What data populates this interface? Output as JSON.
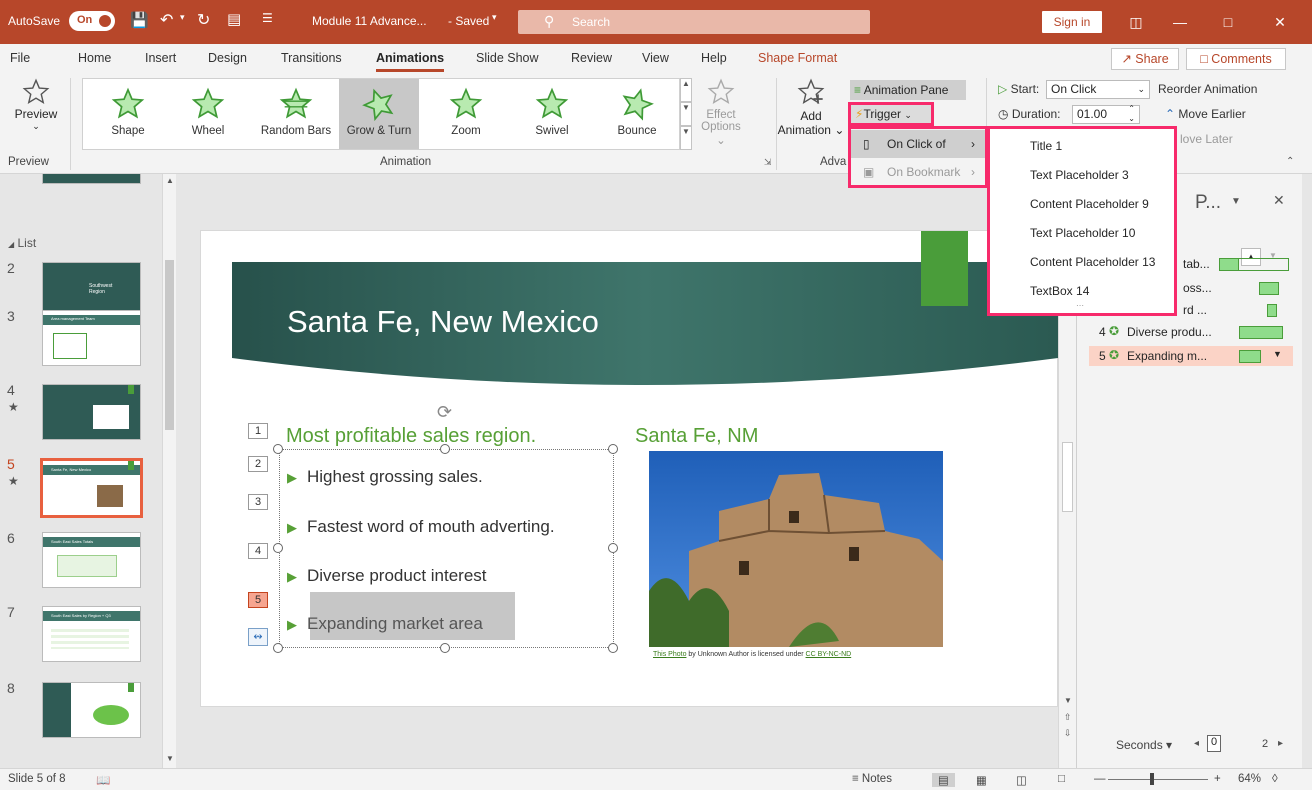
{
  "titlebar": {
    "autosave_label": "AutoSave",
    "autosave_state": "On",
    "doc_title": "Module 11 Advance...",
    "saved_state": "- Saved",
    "search_placeholder": "Search",
    "signin_label": "Sign in",
    "colors": {
      "bar": "#b7472a"
    }
  },
  "tabs": [
    {
      "label": "File"
    },
    {
      "label": "Home"
    },
    {
      "label": "Insert"
    },
    {
      "label": "Design"
    },
    {
      "label": "Transitions"
    },
    {
      "label": "Animations"
    },
    {
      "label": "Slide Show"
    },
    {
      "label": "Review"
    },
    {
      "label": "View"
    },
    {
      "label": "Help"
    },
    {
      "label": "Shape Format"
    }
  ],
  "active_tab": "Animations",
  "share_label": "Share",
  "comments_label": "Comments",
  "ribbon": {
    "preview_label": "Preview",
    "group_preview": "Preview",
    "group_animation": "Animation",
    "group_advanced": "Adva",
    "gallery": [
      "Shape",
      "Wheel",
      "Random Bars",
      "Grow & Turn",
      "Zoom",
      "Swivel",
      "Bounce"
    ],
    "gallery_selected": "Grow & Turn",
    "effect_options": "Effect",
    "effect_options2": "Options",
    "add_animation": "Add",
    "add_animation2": "Animation",
    "animation_pane": "Animation Pane",
    "trigger": "Trigger",
    "start_label": "Start:",
    "start_value": "On Click",
    "duration_label": "Duration:",
    "duration_value": "01.00",
    "reorder": "Reorder Animation",
    "move_earlier": "Move Earlier",
    "move_later": "love Later"
  },
  "trigger_menu": {
    "on_click_of": "On Click of",
    "on_bookmark": "On Bookmark",
    "items": [
      "Title 1",
      "Text Placeholder 3",
      "Content Placeholder 9",
      "Text Placeholder 10",
      "Content Placeholder 13",
      "TextBox 14"
    ]
  },
  "thumbnails": {
    "section": "List",
    "slides": [
      {
        "num": "2",
        "star": "",
        "text": "Southwest Region"
      },
      {
        "num": "3",
        "star": "",
        "text": "Area management Team"
      },
      {
        "num": "4",
        "star": "★",
        "text": ""
      },
      {
        "num": "5",
        "star": "★",
        "text": "Santa Fe, New Mexico"
      },
      {
        "num": "6",
        "star": "",
        "text": "South East Sales Totals"
      },
      {
        "num": "7",
        "star": "",
        "text": "South East Sales by Region + Q3"
      },
      {
        "num": "8",
        "star": "",
        "text": ""
      }
    ],
    "active": "5"
  },
  "slide": {
    "title": "Santa Fe, New Mexico",
    "subhead_left": "Most profitable sales region.",
    "subhead_right": "Santa Fe, NM",
    "bullets": [
      "Highest grossing sales.",
      "Fastest word of mouth adverting.",
      "Diverse product interest",
      "Expanding market area"
    ],
    "anim_tags": [
      "1",
      "2",
      "3",
      "4",
      "5"
    ],
    "caption_link1": "This Photo",
    "caption_mid": " by Unknown Author is licensed under ",
    "caption_link2": "CC BY-NC-ND"
  },
  "animation_pane": {
    "title": "P...",
    "rows": [
      {
        "num": "",
        "label": "tab...",
        "bar": 0.12
      },
      {
        "num": "",
        "label": "oss...",
        "bar": 0.12
      },
      {
        "num": "",
        "label": "rd ...",
        "bar": 0.05
      },
      {
        "num": "4",
        "label": "Diverse produ...",
        "bar": 0.25
      },
      {
        "num": "5",
        "label": "Expanding m...",
        "bar": 0.12
      }
    ],
    "seconds_label": "Seconds",
    "timeline_start": "0",
    "timeline_end": "2"
  },
  "statusbar": {
    "slide_info": "Slide 5 of 8",
    "notes": "Notes",
    "zoom": "64%"
  }
}
